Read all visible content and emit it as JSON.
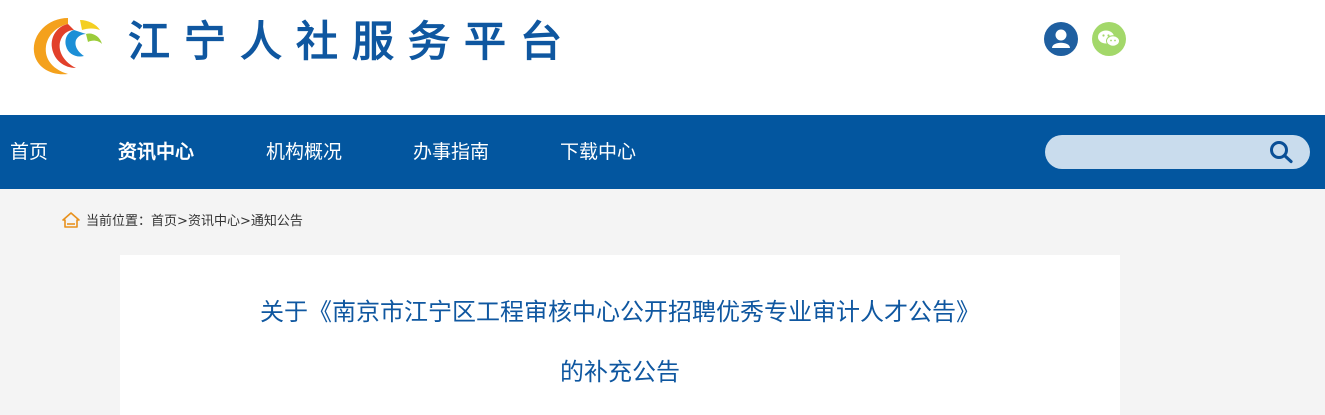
{
  "header": {
    "site_title": "江宁人社服务平台",
    "logo_icon": "phoenix-logo-icon",
    "user_icon": "user-icon",
    "wechat_icon": "wechat-icon"
  },
  "nav": {
    "items": [
      {
        "label": "首页",
        "active": false
      },
      {
        "label": "资讯中心",
        "active": true
      },
      {
        "label": "机构概况",
        "active": false
      },
      {
        "label": "办事指南",
        "active": false
      },
      {
        "label": "下载中心",
        "active": false
      }
    ],
    "search": {
      "value": "",
      "placeholder": "",
      "icon": "search-icon"
    }
  },
  "breadcrumb": {
    "icon": "home-icon",
    "prefix": "当前位置：",
    "items": [
      "首页",
      "资讯中心",
      "通知公告"
    ],
    "separator": ">"
  },
  "article": {
    "title_line_1": "关于《南京市江宁区工程审核中心公开招聘优秀专业审计人才公告》",
    "title_line_2": "的补充公告"
  },
  "colors": {
    "nav_bg": "#03569f",
    "title_blue": "#0f57a0",
    "search_bg": "#c9dced",
    "wechat_green": "#a3d86a",
    "user_blue": "#1f5fa0",
    "home_orange": "#e8911d"
  }
}
